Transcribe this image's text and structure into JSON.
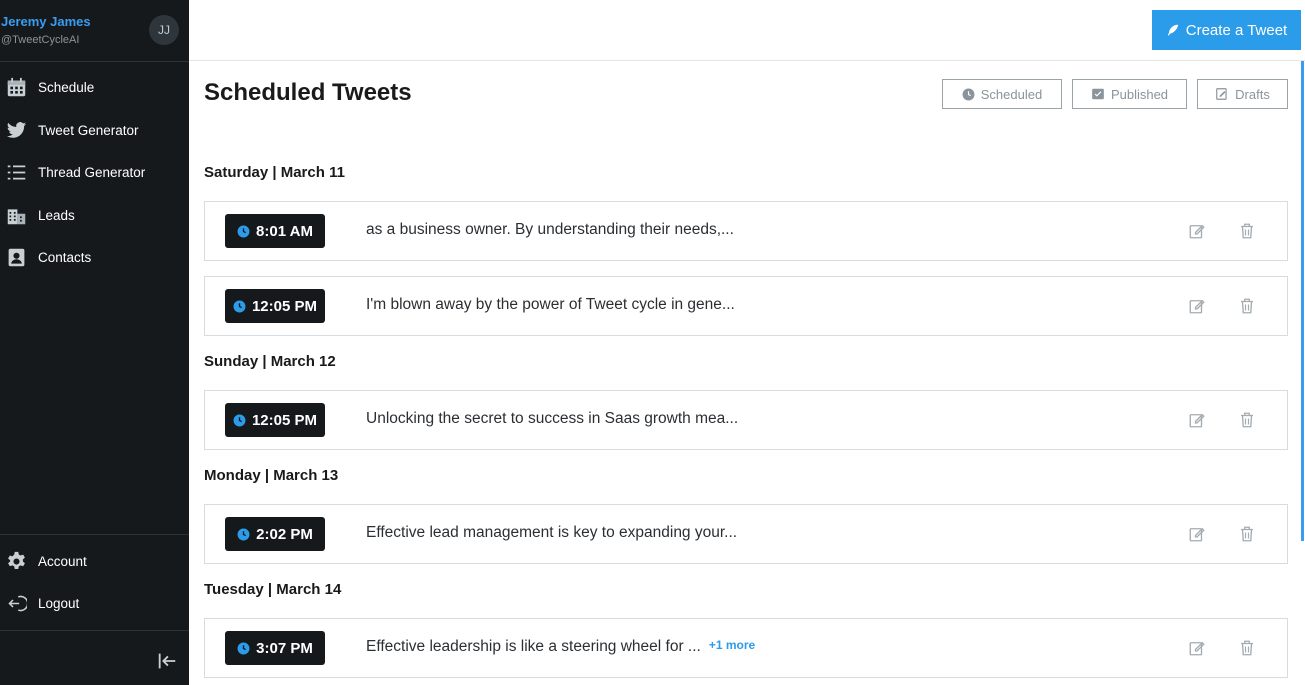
{
  "user": {
    "name": "Jeremy James",
    "handle": "@TweetCycleAI",
    "initials": "JJ"
  },
  "sidebar": {
    "items": [
      {
        "label": "Schedule",
        "icon": "calendar-icon"
      },
      {
        "label": "Tweet Generator",
        "icon": "twitter-bird-icon"
      },
      {
        "label": "Thread Generator",
        "icon": "list-icon"
      },
      {
        "label": "Leads",
        "icon": "building-icon"
      },
      {
        "label": "Contacts",
        "icon": "contact-card-icon"
      }
    ],
    "bottom": [
      {
        "label": "Account",
        "icon": "gear-icon"
      },
      {
        "label": "Logout",
        "icon": "logout-icon"
      }
    ]
  },
  "toolbar": {
    "create_label": "Create a Tweet"
  },
  "page": {
    "title": "Scheduled Tweets",
    "filters": [
      "Scheduled",
      "Published",
      "Drafts"
    ]
  },
  "groups": [
    {
      "day": "Saturday | March 11",
      "tweets": [
        {
          "time": "8:01 AM",
          "text": "as a business owner. By understanding their needs,..."
        },
        {
          "time": "12:05 PM",
          "text": "I'm blown away by the power of Tweet cycle in gene..."
        }
      ]
    },
    {
      "day": "Sunday | March 12",
      "tweets": [
        {
          "time": "12:05 PM",
          "text": "Unlocking the secret to success in Saas growth mea..."
        }
      ]
    },
    {
      "day": "Monday | March 13",
      "tweets": [
        {
          "time": "2:02 PM",
          "text": "Effective lead management is key to expanding your..."
        }
      ]
    },
    {
      "day": "Tuesday | March 14",
      "tweets": [
        {
          "time": "3:07 PM",
          "text": "Effective leadership is like a steering wheel for ...",
          "more": "+1 more"
        }
      ]
    }
  ],
  "colors": {
    "accent": "#2b9ce9",
    "sidebar_bg": "#15191c",
    "time_badge_bg": "#16191c"
  }
}
